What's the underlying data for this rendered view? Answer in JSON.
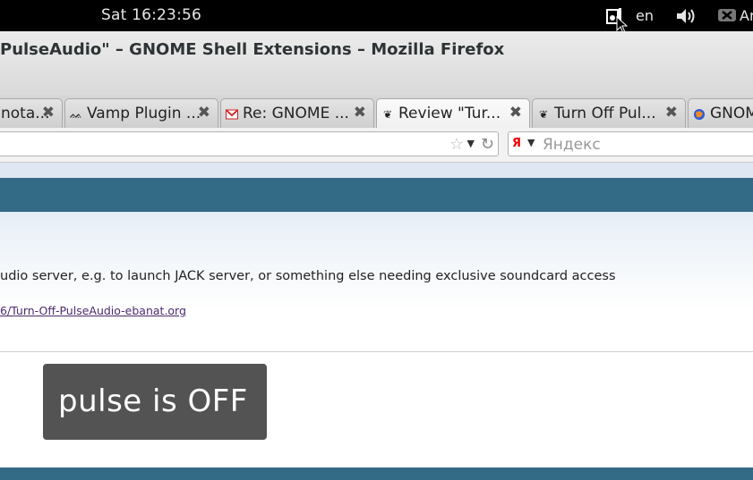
{
  "top_panel": {
    "clock": "Sat 16:23:56",
    "keyboard_layout": "en",
    "user_name": "Ar"
  },
  "window": {
    "title": "PulseAudio\" – GNOME Shell Extensions – Mozilla Firefox"
  },
  "tabs": [
    {
      "label": "nota...",
      "icon": "generic-icon",
      "selected": false
    },
    {
      "label": "Vamp Plugin ...",
      "icon": "vamp-icon",
      "selected": false
    },
    {
      "label": "Re: GNOME ...",
      "icon": "gmail-icon",
      "selected": false
    },
    {
      "label": "Review \"Tur...",
      "icon": "gnome-foot-icon",
      "selected": true
    },
    {
      "label": "Turn Off Pul...",
      "icon": "gnome-foot-icon",
      "selected": false
    },
    {
      "label": "GNOM",
      "icon": "firefox-icon",
      "selected": false
    }
  ],
  "navbar": {
    "search_placeholder": "Яндекс"
  },
  "page": {
    "description": "udio server, e.g. to launch JACK server, or something else needing exclusive soundcard access",
    "homepage_link": "6/Turn-Off-PulseAudio-ebanat.org",
    "status": "pulse is OFF"
  },
  "colors": {
    "accent_blue": "#336b87",
    "status_box": "#535353"
  }
}
